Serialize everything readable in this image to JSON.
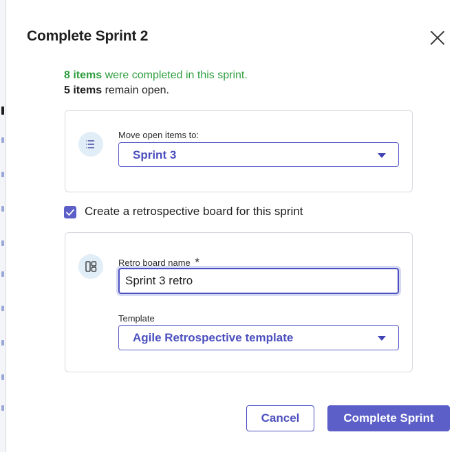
{
  "dialog": {
    "title": "Complete Sprint 2",
    "close_icon": "close-icon"
  },
  "summary": {
    "completed_count": "8 items",
    "completed_text": " were completed in this sprint.",
    "open_count": "5 items",
    "open_text": " remain open."
  },
  "move_items": {
    "icon": "list-icon",
    "label": "Move open items to:",
    "selected": "Sprint 3"
  },
  "retro_checkbox": {
    "checked": true,
    "label": "Create a retrospective board for this sprint"
  },
  "retro_board": {
    "icon": "board-layout-icon",
    "name_label": "Retro board name",
    "required_marker": "*",
    "name_value": "Sprint 3 retro",
    "template_label": "Template",
    "template_selected": "Agile Retrospective template"
  },
  "buttons": {
    "cancel": "Cancel",
    "complete": "Complete Sprint"
  },
  "colors": {
    "accent": "#5b5fc7",
    "accent_text": "#4b4fbe",
    "success_text": "#2e9e3e",
    "icon_bg": "#e1eef7"
  }
}
